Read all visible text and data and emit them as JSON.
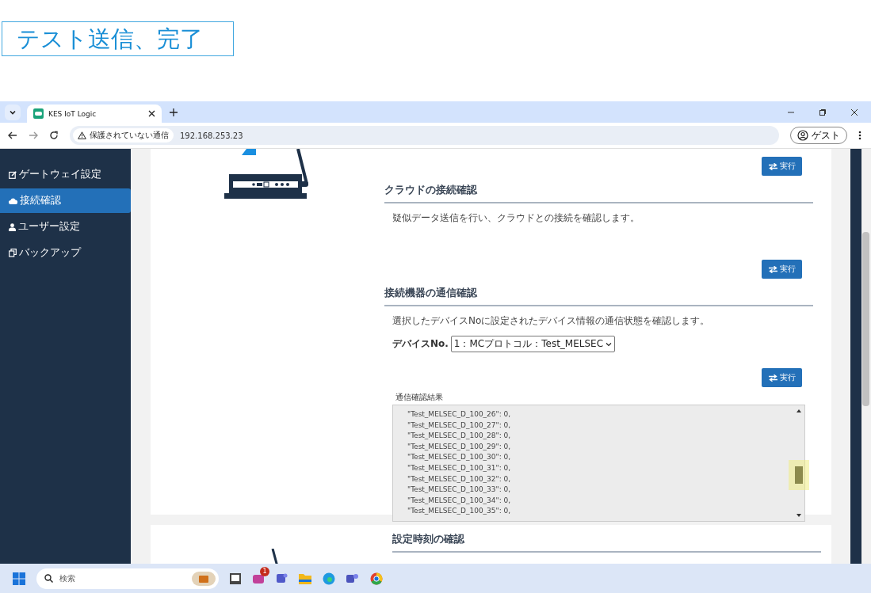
{
  "caption": "テスト送信、完了",
  "browser": {
    "tab_title": "KES IoT Logic",
    "security_label": "保護されていない通信",
    "url": "192.168.253.23",
    "profile": "ゲスト"
  },
  "sidebar": {
    "items": [
      {
        "label": "ゲートウェイ設定",
        "kind": "edit",
        "selected": false
      },
      {
        "label": "接続確認",
        "kind": "cloud",
        "selected": true
      },
      {
        "label": "ユーザー設定",
        "kind": "user",
        "selected": false
      },
      {
        "label": "バックアップ",
        "kind": "copy",
        "selected": false
      }
    ]
  },
  "cloud_check": {
    "button": "実行",
    "title": "クラウドの接続確認",
    "description": "疑似データ送信を行い、クラウドとの接続を確認します。"
  },
  "device_check": {
    "button": "実行",
    "title": "接続機器の通信確認",
    "description": "選択したデバイスNoに設定されたデバイス情報の通信状態を確認します。",
    "device_label": "デバイスNo.",
    "device_value": "1：MCプロトコル：Test_MELSEC",
    "run_button": "実行",
    "result_label": "通信確認結果",
    "result_lines": [
      "\"Test_MELSEC_D_100_26\": 0,",
      "\"Test_MELSEC_D_100_27\": 0,",
      "\"Test_MELSEC_D_100_28\": 0,",
      "\"Test_MELSEC_D_100_29\": 0,",
      "\"Test_MELSEC_D_100_30\": 0,",
      "\"Test_MELSEC_D_100_31\": 0,",
      "\"Test_MELSEC_D_100_32\": 0,",
      "\"Test_MELSEC_D_100_33\": 0,",
      "\"Test_MELSEC_D_100_34\": 0,",
      "\"Test_MELSEC_D_100_35\": 0,"
    ]
  },
  "time_check": {
    "title": "設定時刻の確認"
  },
  "taskbar": {
    "search_placeholder": "検索",
    "badge": "1"
  }
}
